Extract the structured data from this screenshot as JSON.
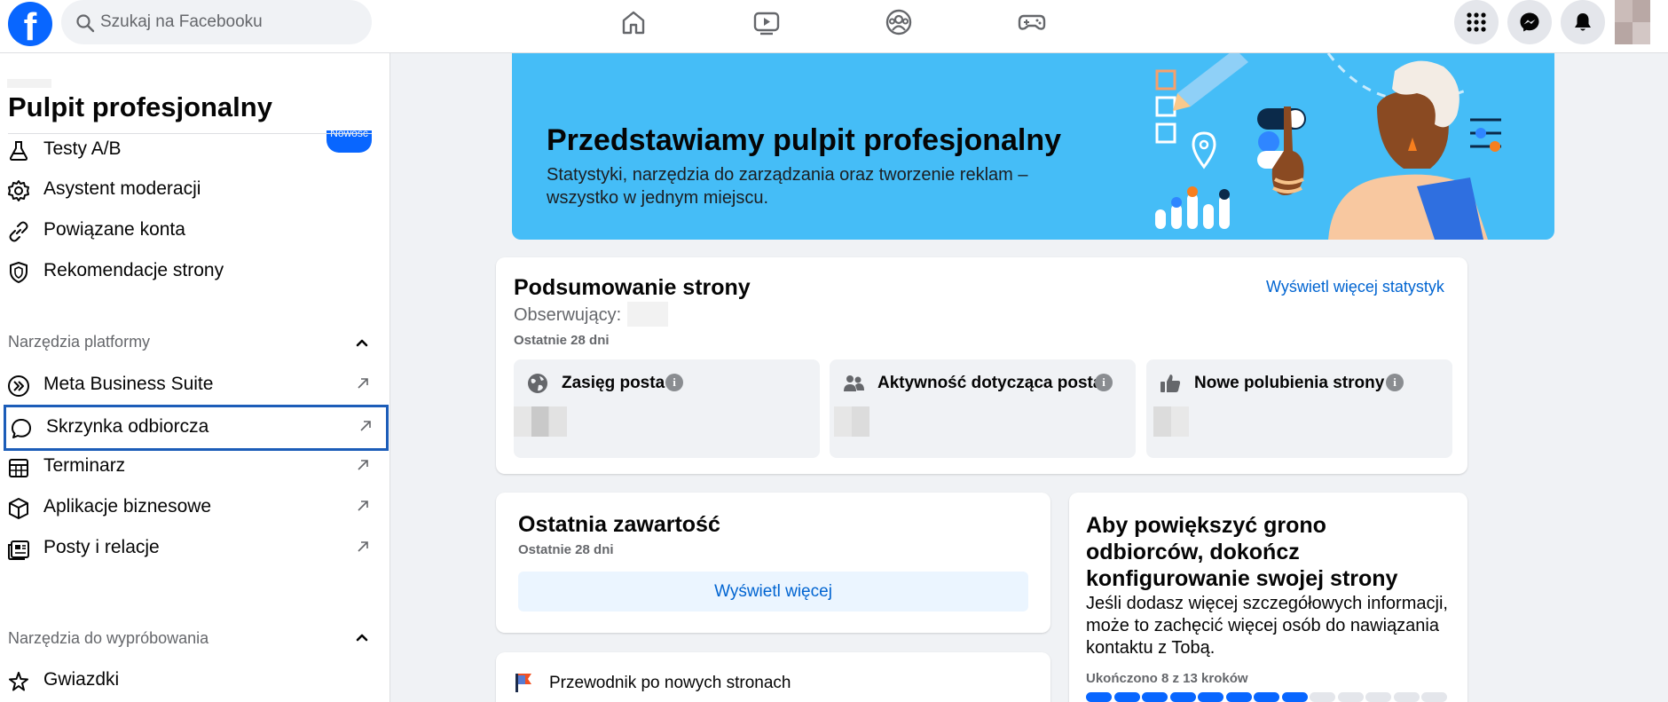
{
  "topbar": {
    "search_placeholder": "Szukaj na Facebooku",
    "logo_letter": "f"
  },
  "sidebar": {
    "title": "Pulpit profesjonalny",
    "badge": "Nowość",
    "items_top": [
      {
        "label": "Testy A/B",
        "icon": "flask-icon"
      },
      {
        "label": "Asystent moderacji",
        "icon": "gear-icon"
      },
      {
        "label": "Powiązane konta",
        "icon": "link-icon"
      },
      {
        "label": "Rekomendacje strony",
        "icon": "shield-icon"
      }
    ],
    "section_platform": "Narzędzia platformy",
    "items_platform": [
      {
        "label": "Meta Business Suite",
        "icon": "meta-business-icon"
      },
      {
        "label": "Skrzynka odbiorcza",
        "icon": "chat-bubble-icon",
        "selected": true
      },
      {
        "label": "Terminarz",
        "icon": "calendar-icon"
      },
      {
        "label": "Aplikacje biznesowe",
        "icon": "cube-icon"
      },
      {
        "label": "Posty i relacje",
        "icon": "posts-icon"
      }
    ],
    "section_try": "Narzędzia do wypróbowania",
    "items_try": [
      {
        "label": "Gwiazdki",
        "icon": "stars-icon"
      }
    ]
  },
  "hero": {
    "title": "Przedstawiamy pulpit profesjonalny",
    "text": "Statystyki, narzędzia do zarządzania oraz tworzenie reklam – wszystko w jednym miejscu."
  },
  "summary": {
    "title": "Podsumowanie strony",
    "followers_label": "Obserwujący:",
    "period": "Ostatnie 28 dni",
    "link": "Wyświetl więcej statystyk",
    "stats": [
      {
        "label": "Zasięg posta",
        "icon": "globe-icon"
      },
      {
        "label": "Aktywność dotycząca posta",
        "icon": "people-icon"
      },
      {
        "label": "Nowe polubienia strony",
        "icon": "thumbs-up-icon"
      }
    ],
    "info_glyph": "i"
  },
  "recent": {
    "title": "Ostatnia zawartość",
    "period": "Ostatnie 28 dni",
    "button": "Wyświetl więcej"
  },
  "guide": {
    "label": "Przewodnik po nowych stronach"
  },
  "setup": {
    "title": "Aby powiększyć grono odbiorców, dokończ konfigurowanie swojej strony",
    "text": "Jeśli dodasz więcej szczegółowych informacji, może to zachęcić więcej osób do nawiązania kontaktu z Tobą.",
    "progress_label": "Ukończono 8 z 13 kroków",
    "steps_done": 8,
    "steps_total": 13
  }
}
